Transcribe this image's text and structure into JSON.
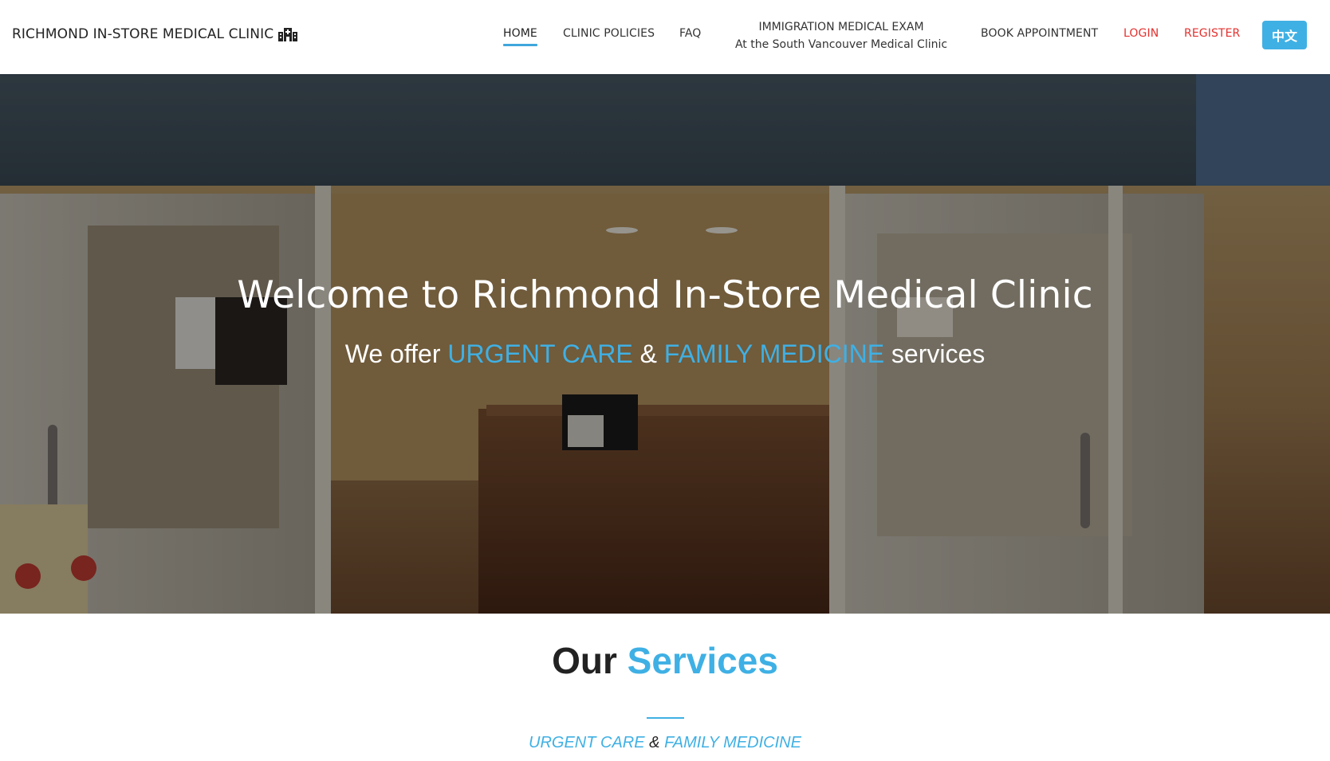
{
  "navbar": {
    "brand": "RICHMOND IN-STORE MEDICAL CLINIC",
    "brand_icon": "hospital-building-icon",
    "links": {
      "home": "HOME",
      "clinic_policies": "CLINIC POLICIES",
      "faq": "FAQ",
      "immigration_line1": "IMMIGRATION MEDICAL EXAM",
      "immigration_line2": "At the South Vancouver Medical Clinic",
      "book_appointment": "BOOK APPOINTMENT",
      "login": "LOGIN",
      "register": "REGISTER"
    },
    "language_button": "中文"
  },
  "hero": {
    "title": "Welcome to Richmond In-Store Medical Clinic",
    "subtitle_prefix": "We offer",
    "subtitle_service1": "URGENT CARE",
    "subtitle_amp": "&",
    "subtitle_service2": "FAMILY MEDICINE",
    "subtitle_suffix": "services"
  },
  "services": {
    "heading_prefix": "Our",
    "heading_highlight": "Services",
    "subtitle_service1": "URGENT CARE",
    "subtitle_amp": "&",
    "subtitle_service2": "FAMILY MEDICINE"
  },
  "colors": {
    "accent": "#3fb0e4",
    "nav_red": "#e3312e",
    "text_dark": "#222222"
  }
}
